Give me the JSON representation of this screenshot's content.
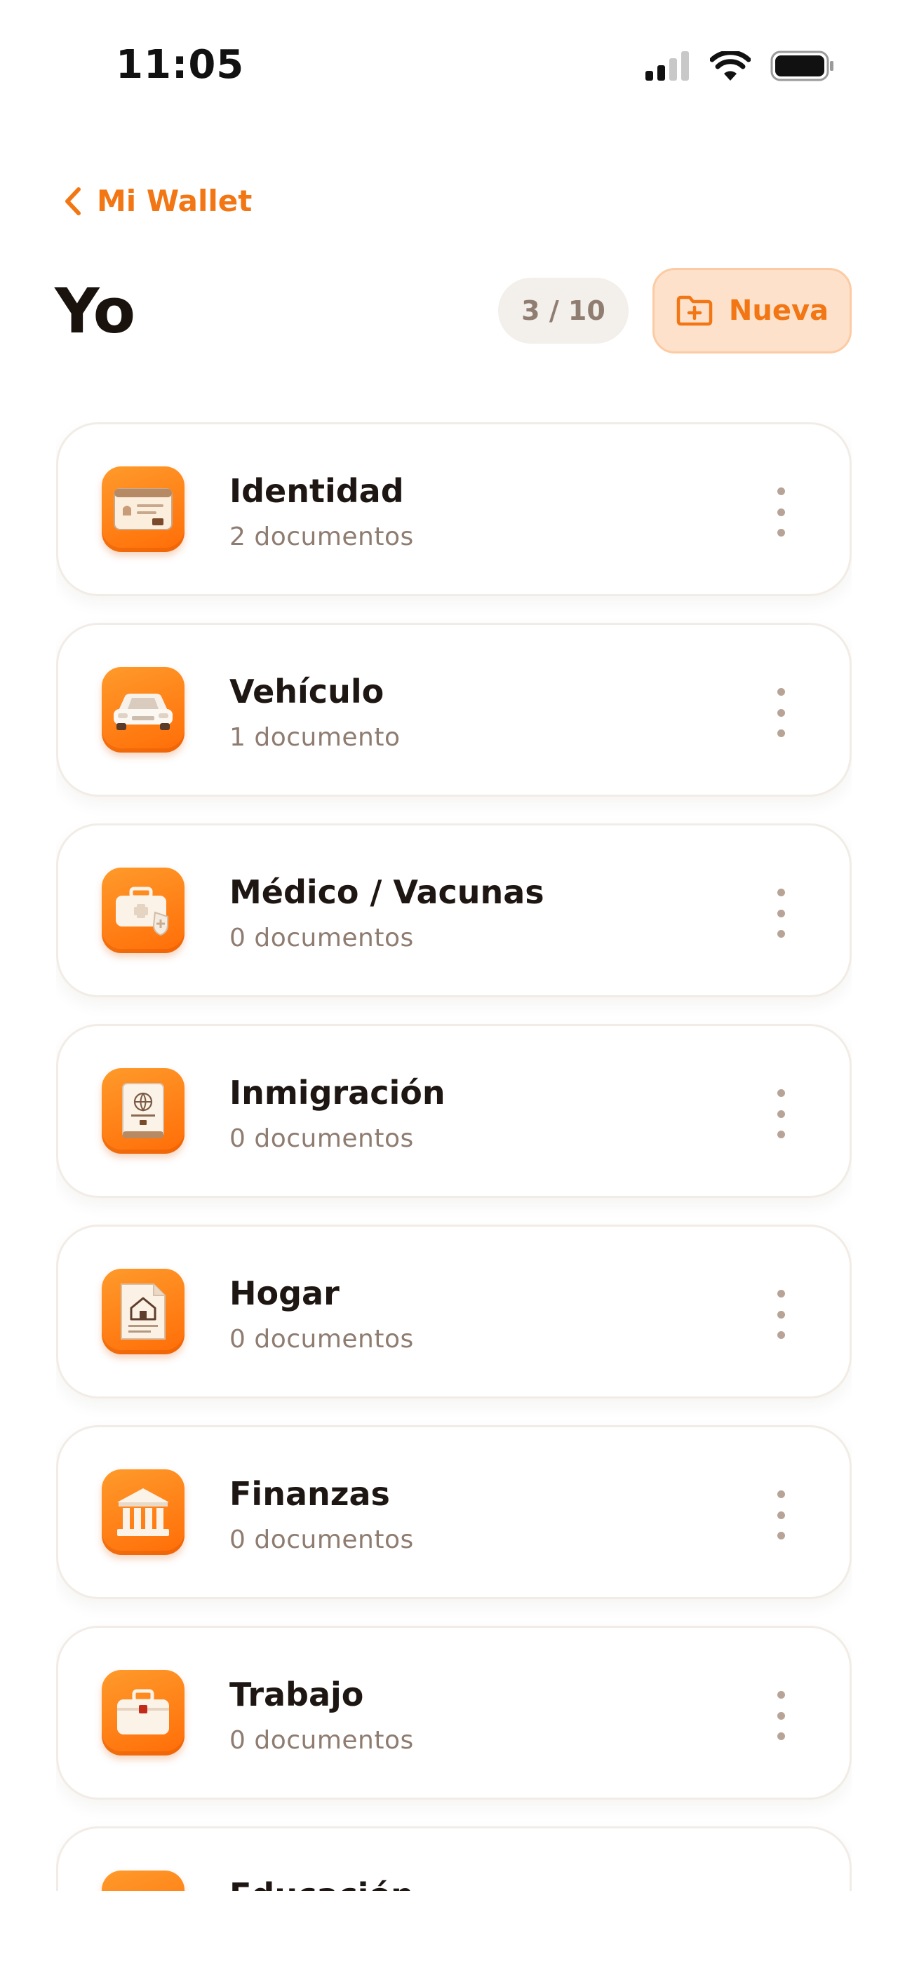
{
  "status_bar": {
    "time": "11:05",
    "icons": [
      "cellular-signal-icon",
      "wifi-icon",
      "battery-icon"
    ]
  },
  "nav": {
    "back_label": "Mi Wallet"
  },
  "header": {
    "title": "Yo",
    "count": "3 / 10",
    "new_label": "Nueva"
  },
  "colors": {
    "accent": "#f27613",
    "icon_gradient_top": "#ff9a2b",
    "icon_gradient_bottom": "#ff6d07",
    "subtitle": "#8f7c70"
  },
  "categories": [
    {
      "title": "Identidad",
      "subtitle": "2 documentos",
      "icon": "id-card-icon"
    },
    {
      "title": "Vehículo",
      "subtitle": "1 documento",
      "icon": "car-icon"
    },
    {
      "title": "Médico / Vacunas",
      "subtitle": "0 documentos",
      "icon": "medical-kit-icon"
    },
    {
      "title": "Inmigración",
      "subtitle": "0 documentos",
      "icon": "passport-icon"
    },
    {
      "title": "Hogar",
      "subtitle": "0 documentos",
      "icon": "house-document-icon"
    },
    {
      "title": "Finanzas",
      "subtitle": "0 documentos",
      "icon": "bank-icon"
    },
    {
      "title": "Trabajo",
      "subtitle": "0 documentos",
      "icon": "briefcase-icon"
    },
    {
      "title": "Educación",
      "subtitle": "",
      "icon": "education-icon"
    }
  ]
}
